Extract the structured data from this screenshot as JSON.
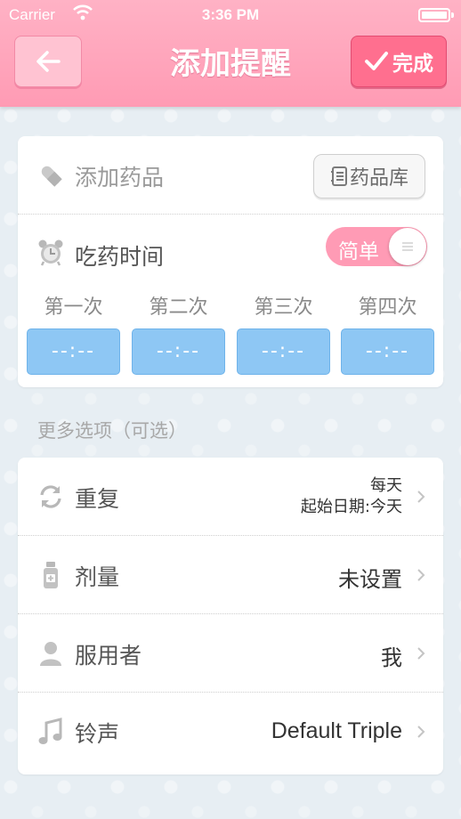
{
  "status_bar": {
    "carrier": "Carrier",
    "time": "3:36 PM"
  },
  "nav": {
    "title": "添加提醒",
    "done_label": "完成"
  },
  "medicine": {
    "add_label": "添加药品",
    "library_label": "药品库"
  },
  "schedule": {
    "label": "吃药时间",
    "mode": "简单",
    "times": [
      {
        "label": "第一次",
        "value": "--:--"
      },
      {
        "label": "第二次",
        "value": "--:--"
      },
      {
        "label": "第三次",
        "value": "--:--"
      },
      {
        "label": "第四次",
        "value": "--:--"
      }
    ]
  },
  "more_options": {
    "title": "更多选项（可选）",
    "repeat": {
      "label": "重复",
      "value_line1": "每天",
      "value_line2": "起始日期:今天"
    },
    "dosage": {
      "label": "剂量",
      "value": "未设置"
    },
    "taker": {
      "label": "服用者",
      "value": "我"
    },
    "ringtone": {
      "label": "铃声",
      "value": "Default Triple"
    }
  },
  "colors": {
    "header": "#ff9bb4",
    "done": "#ff6f8f",
    "time_box": "#8ec7f4",
    "toggle": "#ff9bb5"
  },
  "icons": [
    "back-arrow-icon",
    "checkmark-icon",
    "pill-icon",
    "book-icon",
    "alarm-clock-icon",
    "repeat-icon",
    "medicine-bottle-icon",
    "person-icon",
    "music-note-icon",
    "chevron-right-icon"
  ]
}
